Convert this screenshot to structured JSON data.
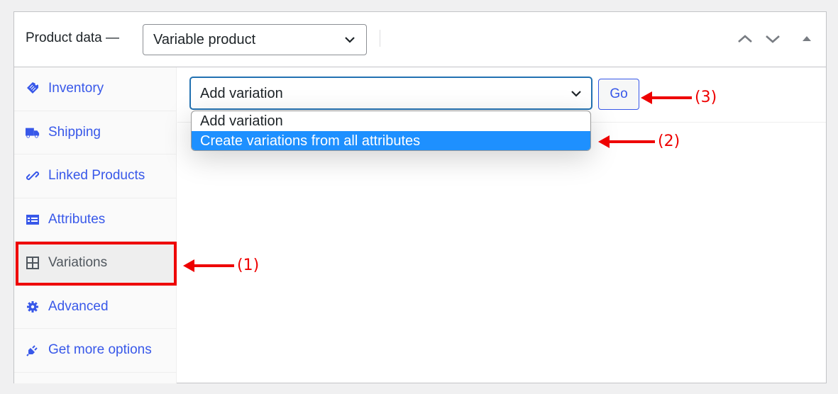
{
  "header": {
    "title": "Product data —",
    "product_type": "Variable product",
    "move_up_label": "Move up",
    "move_down_label": "Move down",
    "toggle_label": "Toggle panel"
  },
  "sidebar": {
    "items": [
      {
        "label": "Inventory",
        "icon": "tag-icon",
        "active": false
      },
      {
        "label": "Shipping",
        "icon": "truck-icon",
        "active": false
      },
      {
        "label": "Linked Products",
        "icon": "link-icon",
        "active": false
      },
      {
        "label": "Attributes",
        "icon": "list-icon",
        "active": false
      },
      {
        "label": "Variations",
        "icon": "grid-icon",
        "active": true
      },
      {
        "label": "Advanced",
        "icon": "gear-icon",
        "active": false
      },
      {
        "label": "Get more options",
        "icon": "plug-icon",
        "active": false
      }
    ]
  },
  "variations": {
    "select_value": "Add variation",
    "options": [
      "Add variation",
      "Create variations from all attributes"
    ],
    "highlighted_option": "Create variations from all attributes",
    "go_label": "Go"
  },
  "annotations": [
    "(1)",
    "(2)",
    "(3)"
  ],
  "colors": {
    "accent": "#3858e9",
    "focus": "#2271b1",
    "highlight": "#1e90ff",
    "annotation": "#ee0000"
  }
}
